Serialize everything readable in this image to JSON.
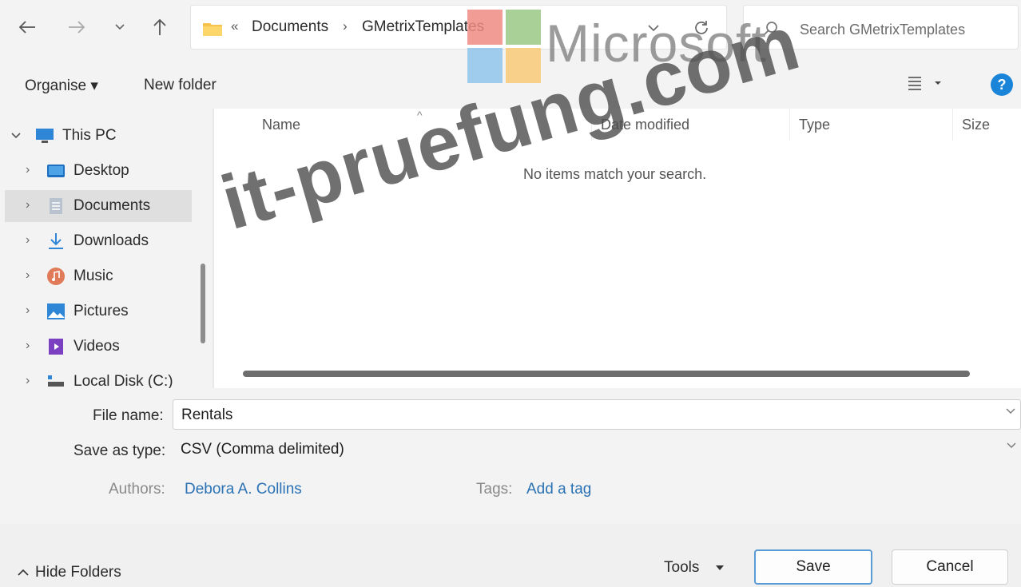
{
  "addressBar": {
    "overflow": "«",
    "crumbs": [
      "Documents",
      "GMetrixTemplates"
    ],
    "separator": "›"
  },
  "search": {
    "placeholder": "Search GMetrixTemplates"
  },
  "nav_icons": {
    "back": "back-arrow-icon",
    "forward": "forward-arrow-icon",
    "recent": "chevron-down-icon",
    "up": "up-arrow-icon",
    "refresh": "refresh-icon"
  },
  "commandBar": {
    "organise": "Organise ▾",
    "newFolder": "New folder"
  },
  "navPane": {
    "items": [
      {
        "label": "This PC",
        "icon": "computer-icon",
        "expanded": true
      },
      {
        "label": "Desktop",
        "icon": "desktop-folder-icon"
      },
      {
        "label": "Documents",
        "icon": "documents-icon",
        "selected": true
      },
      {
        "label": "Downloads",
        "icon": "download-arrow-icon"
      },
      {
        "label": "Music",
        "icon": "music-icon"
      },
      {
        "label": "Pictures",
        "icon": "pictures-icon"
      },
      {
        "label": "Videos",
        "icon": "videos-icon"
      },
      {
        "label": "Local Disk (C:)",
        "icon": "disk-icon"
      }
    ]
  },
  "fileList": {
    "columns": [
      "Name",
      "Date modified",
      "Type",
      "Size"
    ],
    "emptyMessage": "No items match your search."
  },
  "form": {
    "fileNameLabel": "File name:",
    "fileName": "Rentals",
    "saveTypeLabel": "Save as type:",
    "saveType": "CSV (Comma delimited)",
    "authorsLabel": "Authors:",
    "authors": "Debora A. Collins",
    "tagsLabel": "Tags:",
    "tags": "Add a tag"
  },
  "bottomBar": {
    "hideFolders": "Hide Folders",
    "tools": "Tools",
    "save": "Save",
    "cancel": "Cancel"
  },
  "watermarks": {
    "logoText": "Microsoft",
    "siteText": "it-pruefung.com"
  },
  "colors": {
    "accent": "#1a84d8",
    "link": "#2a72b5",
    "selection": "#dfdfdf"
  }
}
